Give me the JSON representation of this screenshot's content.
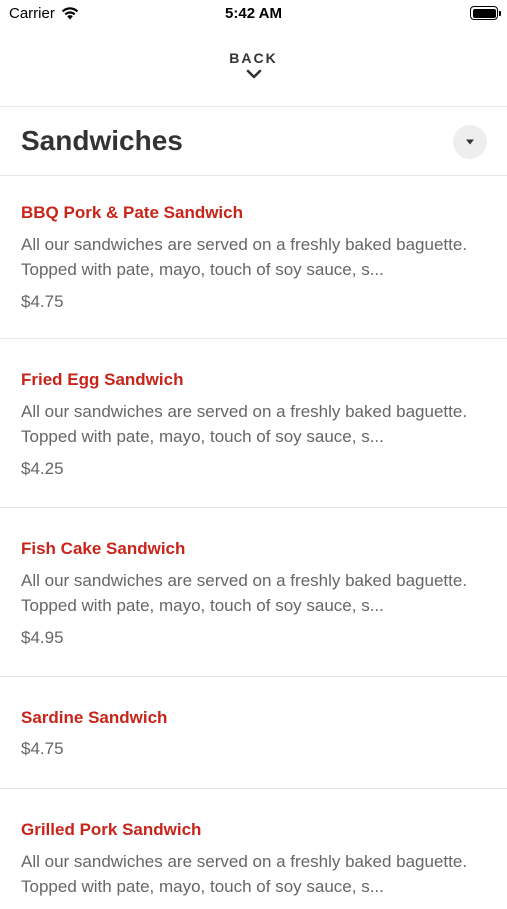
{
  "status_bar": {
    "carrier": "Carrier",
    "time": "5:42 AM"
  },
  "nav": {
    "back_label": "BACK"
  },
  "section": {
    "title": "Sandwiches"
  },
  "colors": {
    "item_name": "#c8241a",
    "text_secondary": "#666666",
    "heading": "#333333"
  },
  "items": [
    {
      "name": "BBQ Pork & Pate Sandwich",
      "description": "All our sandwiches are served on a freshly baked baguette. Topped with pate, mayo, touch of soy sauce, s...",
      "price": "$4.75"
    },
    {
      "name": "Fried Egg Sandwich",
      "description": "All our sandwiches are served on a freshly baked baguette. Topped with pate, mayo, touch of soy sauce, s...",
      "price": "$4.25"
    },
    {
      "name": "Fish Cake Sandwich",
      "description": "All our sandwiches are served on a freshly baked baguette. Topped with pate, mayo, touch of soy sauce, s...",
      "price": "$4.95"
    },
    {
      "name": "Sardine Sandwich",
      "description": "",
      "price": "$4.75"
    },
    {
      "name": "Grilled Pork Sandwich",
      "description": "All our sandwiches are served on a freshly baked baguette. Topped with pate, mayo, touch of soy sauce, s...",
      "price": ""
    }
  ]
}
